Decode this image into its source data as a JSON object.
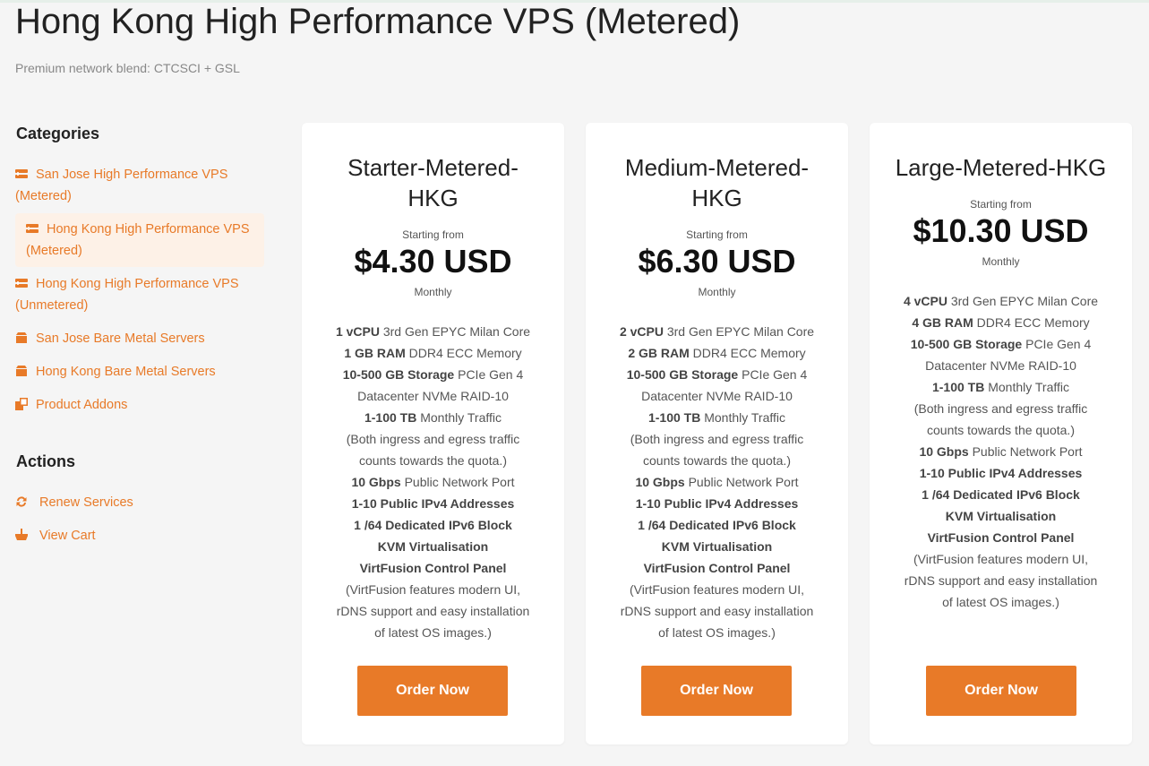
{
  "header": {
    "title": "Hong Kong High Performance VPS (Metered)",
    "subtitle": "Premium network blend: CTCSCI + GSL"
  },
  "sidebar": {
    "categories_heading": "Categories",
    "categories": [
      {
        "line1": "San Jose High Performance VPS",
        "line2": "(Metered)",
        "icon": "server-icon",
        "active": false
      },
      {
        "line1": "Hong Kong High Performance VPS",
        "line2": "(Metered)",
        "icon": "server-icon",
        "active": true
      },
      {
        "line1": "Hong Kong High Performance VPS",
        "line2": "(Unmetered)",
        "icon": "server-icon",
        "active": false
      },
      {
        "line1": "San Jose Bare Metal Servers",
        "icon": "box-icon",
        "active": false
      },
      {
        "line1": "Hong Kong Bare Metal Servers",
        "icon": "box-icon",
        "active": false
      },
      {
        "line1": "Product Addons",
        "icon": "addons-icon",
        "active": false
      }
    ],
    "actions_heading": "Actions",
    "actions": [
      {
        "label": "Renew Services",
        "icon": "sync-icon"
      },
      {
        "label": "View Cart",
        "icon": "basket-icon"
      }
    ]
  },
  "products": [
    {
      "name_line1": "Starter-Metered-",
      "name_line2": "HKG",
      "starting_from": "Starting from",
      "price": "$4.30 USD",
      "cycle": "Monthly",
      "features": [
        {
          "bold": "1 vCPU",
          "text": " 3rd Gen EPYC Milan Core"
        },
        {
          "bold": "1 GB RAM",
          "text": " DDR4 ECC Memory"
        },
        {
          "bold": "10-500 GB Storage",
          "text": " PCIe Gen 4"
        },
        {
          "bold": "",
          "text": "Datacenter NVMe RAID-10"
        },
        {
          "bold": "1-100 TB",
          "text": " Monthly Traffic"
        },
        {
          "bold": "",
          "text": "(Both ingress and egress traffic"
        },
        {
          "bold": "",
          "text": "counts towards the quota.)"
        },
        {
          "bold": "10 Gbps",
          "text": " Public Network Port"
        },
        {
          "bold": "1-10 Public IPv4 Addresses",
          "text": ""
        },
        {
          "bold": "1 /64 Dedicated IPv6 Block",
          "text": ""
        },
        {
          "bold": "KVM Virtualisation",
          "text": ""
        },
        {
          "bold": "VirtFusion Control Panel",
          "text": ""
        },
        {
          "bold": "",
          "text": "(VirtFusion features modern UI,"
        },
        {
          "bold": "",
          "text": "rDNS support and easy installation"
        },
        {
          "bold": "",
          "text": "of latest OS images.)"
        }
      ],
      "button": "Order Now"
    },
    {
      "name_line1": "Medium-Metered-",
      "name_line2": "HKG",
      "starting_from": "Starting from",
      "price": "$6.30 USD",
      "cycle": "Monthly",
      "features": [
        {
          "bold": "2 vCPU",
          "text": " 3rd Gen EPYC Milan Core"
        },
        {
          "bold": "2 GB RAM",
          "text": " DDR4 ECC Memory"
        },
        {
          "bold": "10-500 GB Storage",
          "text": " PCIe Gen 4"
        },
        {
          "bold": "",
          "text": "Datacenter NVMe RAID-10"
        },
        {
          "bold": "1-100 TB",
          "text": " Monthly Traffic"
        },
        {
          "bold": "",
          "text": "(Both ingress and egress traffic"
        },
        {
          "bold": "",
          "text": "counts towards the quota.)"
        },
        {
          "bold": "10 Gbps",
          "text": " Public Network Port"
        },
        {
          "bold": "1-10 Public IPv4 Addresses",
          "text": ""
        },
        {
          "bold": "1 /64 Dedicated IPv6 Block",
          "text": ""
        },
        {
          "bold": "KVM Virtualisation",
          "text": ""
        },
        {
          "bold": "VirtFusion Control Panel",
          "text": ""
        },
        {
          "bold": "",
          "text": "(VirtFusion features modern UI,"
        },
        {
          "bold": "",
          "text": "rDNS support and easy installation"
        },
        {
          "bold": "",
          "text": "of latest OS images.)"
        }
      ],
      "button": "Order Now"
    },
    {
      "name_line1": "Large-Metered-HKG",
      "name_line2": "",
      "starting_from": "Starting from",
      "price": "$10.30 USD",
      "cycle": "Monthly",
      "features": [
        {
          "bold": "4 vCPU",
          "text": " 3rd Gen EPYC Milan Core"
        },
        {
          "bold": "4 GB RAM",
          "text": " DDR4 ECC Memory"
        },
        {
          "bold": "10-500 GB Storage",
          "text": " PCIe Gen 4"
        },
        {
          "bold": "",
          "text": "Datacenter NVMe RAID-10"
        },
        {
          "bold": "1-100 TB",
          "text": " Monthly Traffic"
        },
        {
          "bold": "",
          "text": "(Both ingress and egress traffic"
        },
        {
          "bold": "",
          "text": "counts towards the quota.)"
        },
        {
          "bold": "10 Gbps",
          "text": " Public Network Port"
        },
        {
          "bold": "1-10 Public IPv4 Addresses",
          "text": ""
        },
        {
          "bold": "1 /64 Dedicated IPv6 Block",
          "text": ""
        },
        {
          "bold": "KVM Virtualisation",
          "text": ""
        },
        {
          "bold": "VirtFusion Control Panel",
          "text": ""
        },
        {
          "bold": "",
          "text": "(VirtFusion features modern UI,"
        },
        {
          "bold": "",
          "text": "rDNS support and easy installation"
        },
        {
          "bold": "",
          "text": "of latest OS images.)"
        }
      ],
      "button": "Order Now"
    }
  ],
  "colors": {
    "accent": "#e87a28",
    "active_bg": "#fdf1e7",
    "background": "#f5f5f5"
  }
}
